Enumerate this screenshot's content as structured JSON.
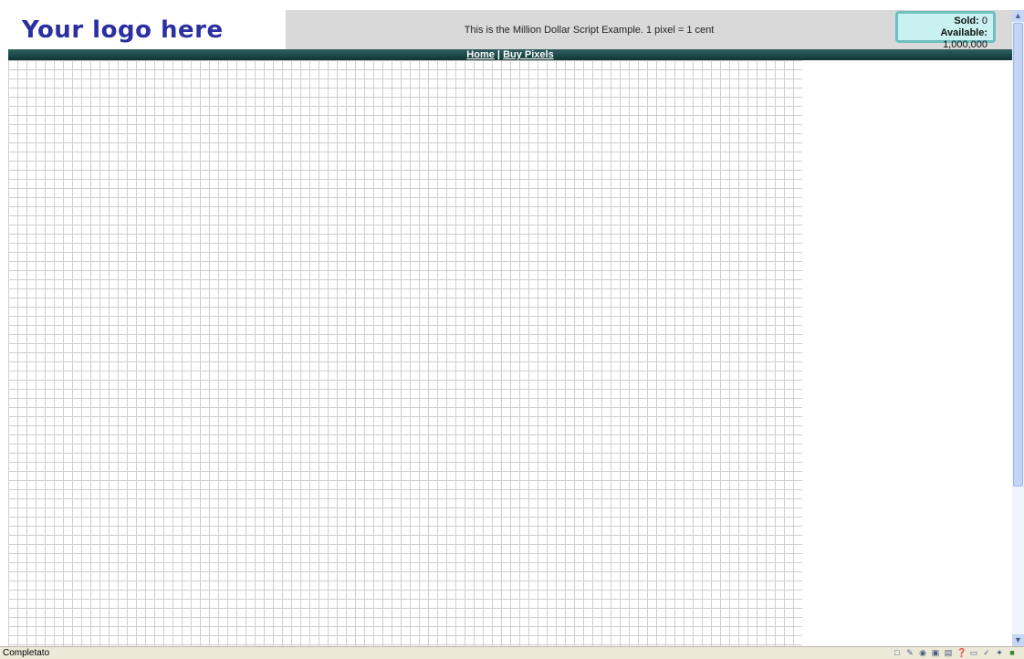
{
  "header": {
    "logo_text": "Your logo here",
    "description": "This is the Million Dollar Script Example. 1 pixel = 1 cent",
    "stats": {
      "sold_label": "Sold:",
      "sold_value": "0",
      "available_label": "Available:",
      "available_value": "1,000,000"
    }
  },
  "nav": {
    "home": "Home",
    "separator": "|",
    "buy_pixels": "Buy Pixels"
  },
  "statusbar": {
    "text": "Completato",
    "icons": [
      "page-icon",
      "pencil-icon",
      "globe-icon",
      "save-icon",
      "print-icon",
      "help-icon",
      "folder-icon",
      "edit-icon",
      "tools-icon",
      "shield-icon"
    ]
  },
  "colors": {
    "logo": "#2b2fa0",
    "header_bg": "#d9d9d9",
    "stats_bg": "#c9f1f1",
    "navbar_bg": "#184344",
    "grid_line": "#cfcfcf"
  }
}
